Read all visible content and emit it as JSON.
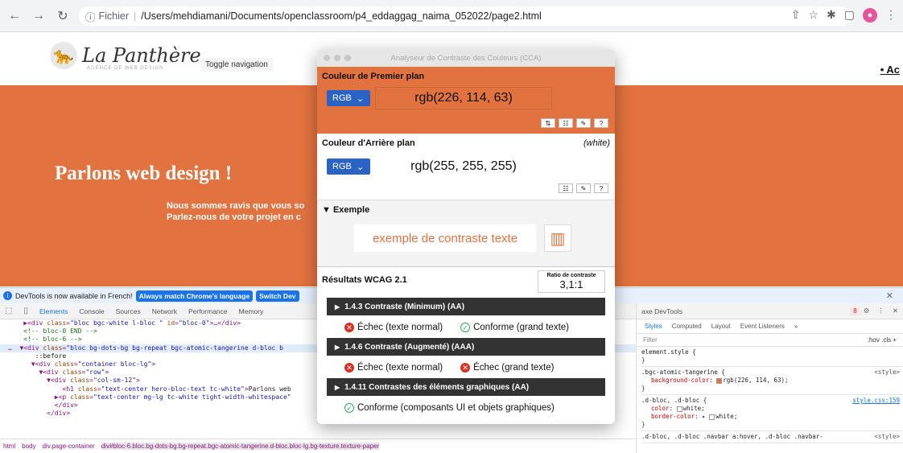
{
  "browser": {
    "url_scheme": "Fichier",
    "url_path": "/Users/mehdiamani/Documents/openclassroom/p4_eddaggag_naima_052022/page2.html"
  },
  "site": {
    "logo_text": "La Panthère",
    "logo_sub": "AGENCE DE WEB DESIGN",
    "toggle_nav": "Toggle navigation",
    "nav_link": "• Ac",
    "hero_title": "Parlons web design !",
    "hero_line1": "Nous sommes ravis que vous so",
    "hero_line2": "Parlez-nous de votre projet en c",
    "hero_color": "#e2723f"
  },
  "devtools": {
    "notice": "DevTools is now available in French!",
    "btn_match": "Always match Chrome's language",
    "btn_switch": "Switch Dev",
    "tabs": [
      "Elements",
      "Console",
      "Sources",
      "Network",
      "Performance",
      "Memory"
    ],
    "breadcrumbs": [
      "html",
      "body",
      "div.page-container",
      "div#bloc-6.bloc.bg-dots-bg.bg-repeat.bgc-atomic-tangerine.d-bloc.bloc-lg.bg-texture.texture-paper"
    ],
    "axe_label": "axe DevTools",
    "error_count": "8",
    "style_tabs": [
      "Styles",
      "Computed",
      "Layout",
      "Event Listeners"
    ],
    "filter_placeholder": "Filter",
    "filter_right": ":hov  .cls  +",
    "rule_element": "element.style {",
    "rule1_sel": ".bgc-atomic-tangerine {",
    "rule1_src": "<style>",
    "rule1_prop": "background-color:",
    "rule1_val": "rgb(226, 114, 63);",
    "rule2_sel": ".d-bloc, .d-bloc {",
    "rule2_src": "style.css:159",
    "rule2_prop1": "color:",
    "rule2_val1": "white;",
    "rule2_prop2": "border-color:",
    "rule2_val2": "white;",
    "rule3_sel": ".d-bloc, .d-bloc .navbar a:hover, .d-bloc .navbar-",
    "rule3_src": "<style>"
  },
  "cca": {
    "title": "Analyseur de Contraste des Couleurs (CCA)",
    "fg_label": "Couleur de Premier plan",
    "fg_format": "RGB",
    "fg_value": "rgb(226, 114, 63)",
    "bg_label": "Couleur d'Arrière plan",
    "bg_tag": "(white)",
    "bg_format": "RGB",
    "bg_value": "rgb(255, 255, 255)",
    "example_label": "▼ Exemple",
    "example_text": "exemple de contraste texte",
    "results_label": "Résultats WCAG 2.1",
    "ratio_label": "Ratio de contraste",
    "ratio_value": "3,1:1",
    "criteria": [
      {
        "title": "1.4.3 Contraste (Minimum) (AA)",
        "r1": "Échec (texte normal)",
        "r2": "Conforme (grand texte)"
      },
      {
        "title": "1.4.6 Contraste (Augmenté) (AAA)",
        "r1": "Échec (texte normal)",
        "r2": "Échec (grand texte)"
      },
      {
        "title": "1.4.11 Contrastes des éléments graphiques (AA)",
        "r1": "Conforme (composants UI et objets graphiques)"
      }
    ]
  }
}
